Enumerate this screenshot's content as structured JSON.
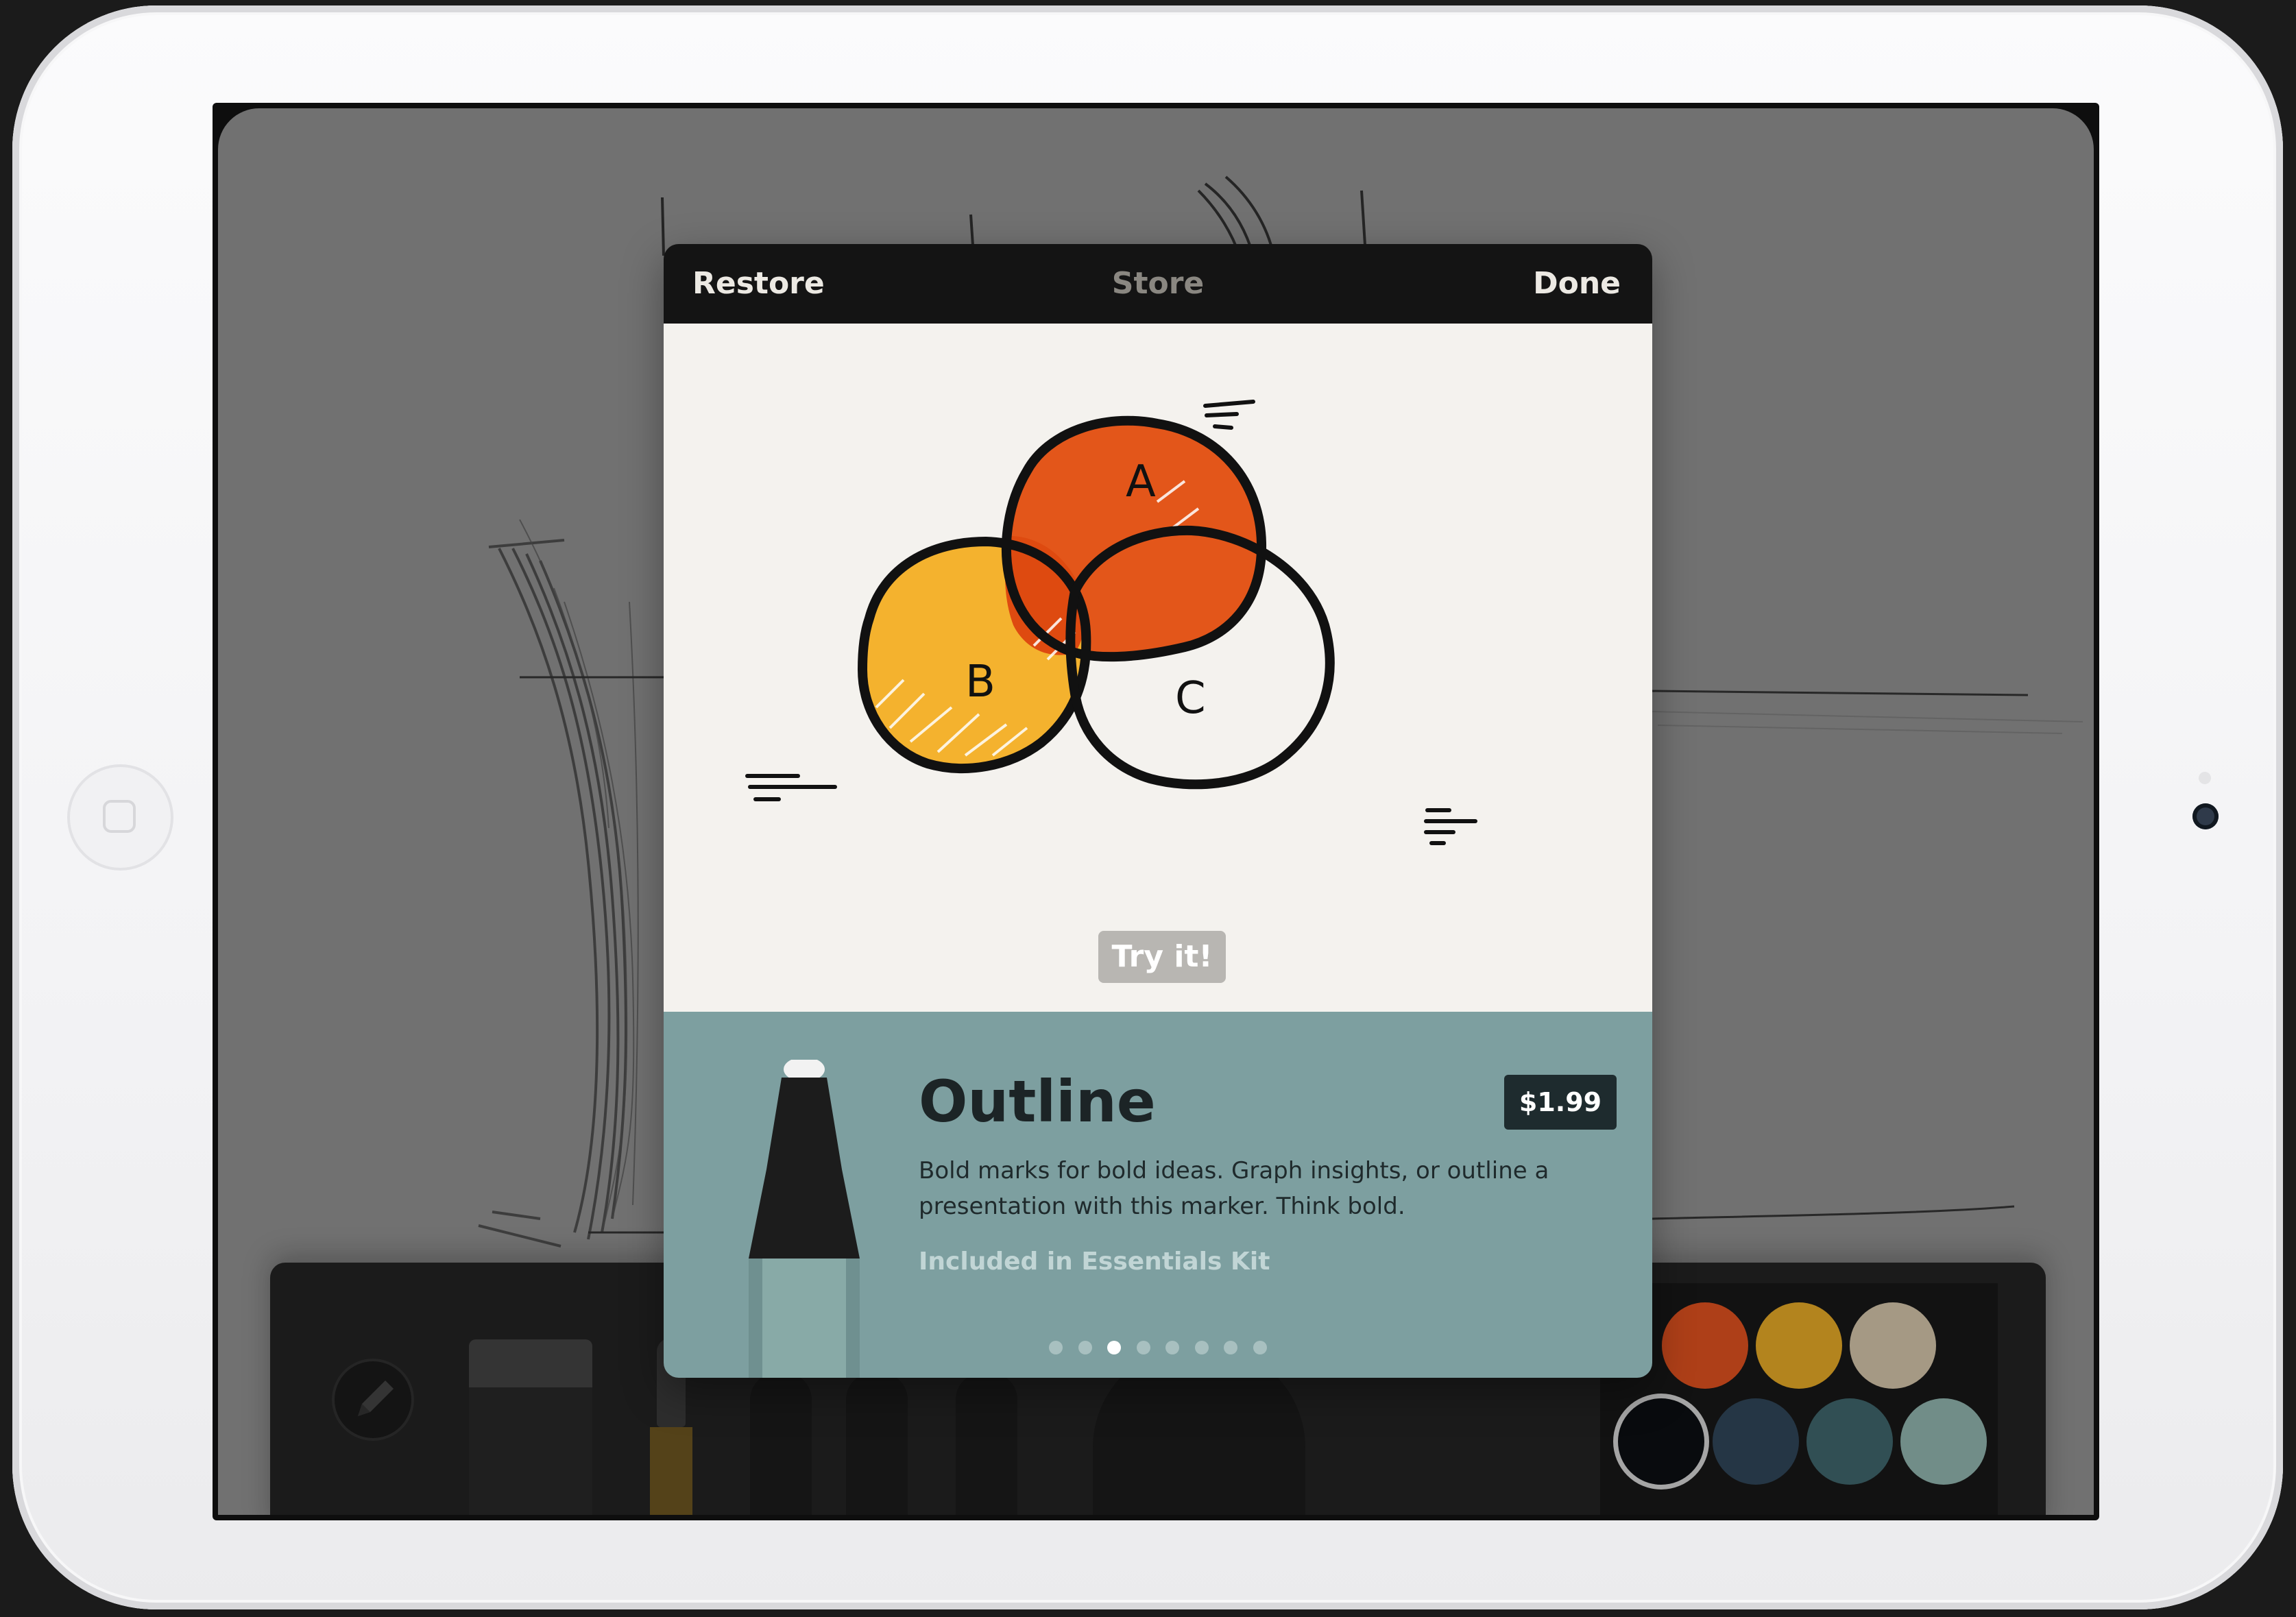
{
  "store": {
    "header": {
      "restore_label": "Restore",
      "title": "Store",
      "done_label": "Done"
    },
    "preview": {
      "venn_labels": [
        "A",
        "B",
        "C"
      ],
      "try_label": "Try it!"
    },
    "product": {
      "name": "Outline",
      "price": "$1.99",
      "description": "Bold marks for bold ideas. Graph insights, or outline a presentation with this marker. Think bold.",
      "kit_note": "Included in Essentials Kit"
    },
    "pager": {
      "count": 8,
      "active_index": 2
    }
  },
  "toolbar": {
    "tools": [
      "pen-tool-button",
      "eraser",
      "brush",
      "fountain-pen",
      "pencil",
      "marker",
      "blender"
    ],
    "palette": {
      "colors": [
        "#c2471b",
        "#c89322",
        "#b8ab94",
        "#0b0d10",
        "#2a3d4d",
        "#37595e",
        "#7e9e98"
      ],
      "selected_color": "#0b0d10"
    }
  },
  "colors": {
    "header_bg": "#141414",
    "info_bg": "#7d9fa0",
    "venn_orange": "#e3561a",
    "venn_yellow": "#f4b22e",
    "canvas_bg": "#7e7e7e"
  }
}
